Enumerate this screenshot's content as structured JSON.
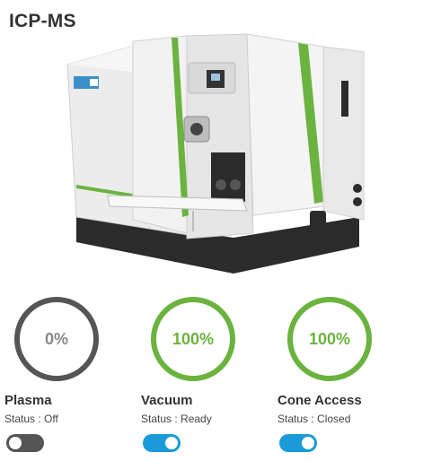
{
  "header": {
    "title": "ICP-MS"
  },
  "colors": {
    "off": "#555555",
    "on_ring": "#6bb33f",
    "toggle_on": "#1a9bd7",
    "toggle_off": "#555555"
  },
  "panels": [
    {
      "name": "Plasma",
      "percent_label": "0%",
      "level": 0,
      "status_text": "Status : Off",
      "toggle_on": false
    },
    {
      "name": "Vacuum",
      "percent_label": "100%",
      "level": 1,
      "status_text": "Status : Ready",
      "toggle_on": true
    },
    {
      "name": "Cone Access",
      "percent_label": "100%",
      "level": 1,
      "status_text": "Status : Closed",
      "toggle_on": true
    }
  ]
}
